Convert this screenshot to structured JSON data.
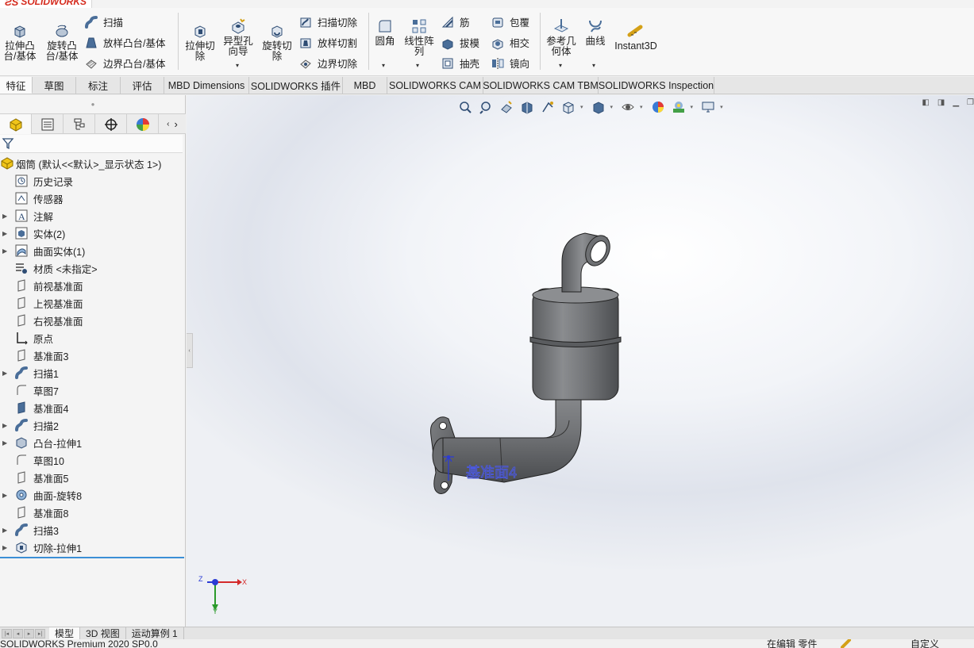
{
  "app": {
    "logo_text": "SOLIDWORKS",
    "status_text": "SOLIDWORKS Premium 2020 SP0.0",
    "status_editing": "在编辑 零件",
    "status_units": "自定义"
  },
  "ribbon": {
    "extrude_boss": "拉伸凸\n台/基体",
    "revolve_boss": "旋转凸\n台/基体",
    "sweep": "扫描",
    "loft_boss": "放样凸台/基体",
    "boundary_boss": "边界凸台/基体",
    "extrude_cut": "拉伸切\n除",
    "hole_wizard": "异型孔\n向导",
    "revolve_cut": "旋转切\n除",
    "sweep_cut": "扫描切除",
    "loft_cut": "放样切割",
    "boundary_cut": "边界切除",
    "fillet": "圆角",
    "linear_pattern": "线性阵\n列",
    "rib": "筋",
    "draft": "拔模",
    "shell": "抽壳",
    "wrap": "包覆",
    "intersect": "相交",
    "mirror": "镜向",
    "ref_geometry": "参考几\n何体",
    "curves": "曲线",
    "instant3d": "Instant3D"
  },
  "command_tabs": [
    "特征",
    "草图",
    "标注",
    "评估",
    "MBD Dimensions",
    "SOLIDWORKS 插件",
    "MBD",
    "SOLIDWORKS CAM",
    "SOLIDWORKS CAM TBM",
    "SOLIDWORKS Inspection"
  ],
  "tree": {
    "root": "烟筒  (默认<<默认>_显示状态 1>)",
    "items": [
      "历史记录",
      "传感器",
      "注解",
      "实体(2)",
      "曲面实体(1)",
      "材质 <未指定>",
      "前视基准面",
      "上视基准面",
      "右视基准面",
      "原点",
      "基准面3",
      "扫描1",
      "草图7",
      "基准面4",
      "扫描2",
      "凸台-拉伸1",
      "草图10",
      "基准面5",
      "曲面-旋转8",
      "基准面8",
      "扫描3",
      "切除-拉伸1"
    ]
  },
  "viewport": {
    "plane_label": "基准面4",
    "triad_x": "X",
    "triad_y": "Y",
    "triad_z": "Z"
  },
  "bottom_tabs": [
    "模型",
    "3D 视图",
    "运动算例 1"
  ],
  "colors": {
    "accent_blue": "#3b8fd6",
    "logo_red": "#d52b1e",
    "model_gray": "#6d6f72"
  }
}
